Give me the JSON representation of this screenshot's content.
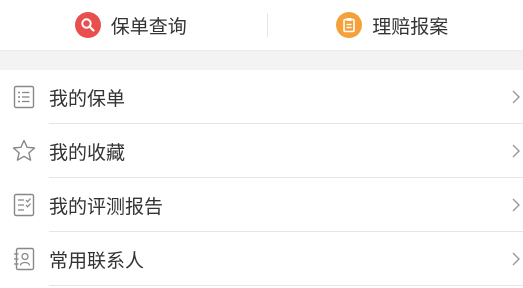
{
  "top_actions": [
    {
      "label": "保单查询",
      "icon": "search-icon",
      "color": "#ea4f4f"
    },
    {
      "label": "理赔报案",
      "icon": "clipboard-icon",
      "color": "#f4a13a"
    }
  ],
  "menu": [
    {
      "label": "我的保单",
      "icon": "list-icon"
    },
    {
      "label": "我的收藏",
      "icon": "star-icon"
    },
    {
      "label": "我的评测报告",
      "icon": "report-icon"
    },
    {
      "label": "常用联系人",
      "icon": "contacts-icon"
    }
  ]
}
